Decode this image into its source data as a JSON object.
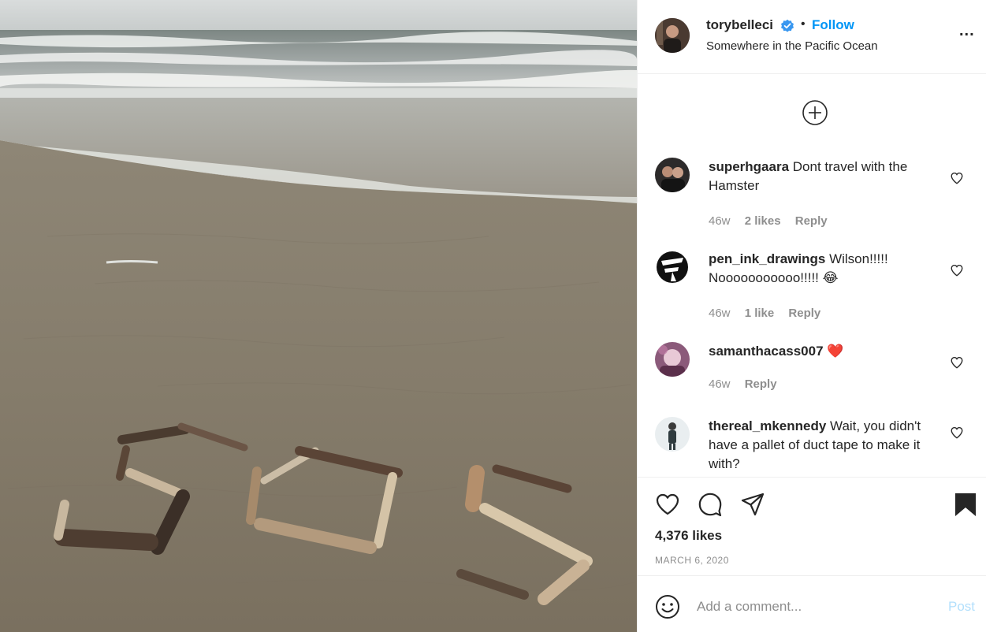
{
  "header": {
    "username": "torybelleci",
    "separator": "•",
    "follow_label": "Follow",
    "location": "Somewhere in the Pacific Ocean",
    "more_label": "..."
  },
  "comments": [
    {
      "username": "superhgaara",
      "text": "Dont travel with the Hamster",
      "time": "46w",
      "likes": "2 likes",
      "reply": "Reply"
    },
    {
      "username": "pen_ink_drawings",
      "text": "Wilson!!!!! Nooooooooooo!!!!! 😂",
      "time": "46w",
      "likes": "1 like",
      "reply": "Reply"
    },
    {
      "username": "samanthacass007",
      "text": "❤️",
      "time": "46w",
      "reply": "Reply"
    },
    {
      "username": "thereal_mkennedy",
      "text": "Wait, you didn't have a pallet of duct tape to make it with?"
    }
  ],
  "post": {
    "likes_text": "4,376 likes",
    "date": "MARCH 6, 2020"
  },
  "add_comment": {
    "placeholder": "Add a comment...",
    "post_label": "Post"
  },
  "icons": {
    "verified": "verified-badge-icon",
    "load_more": "plus-circle-icon",
    "comment_like": "heart-outline-icon",
    "like": "heart-outline-icon",
    "comment": "speech-bubble-icon",
    "share": "paper-plane-icon",
    "save": "bookmark-filled-icon",
    "emoji": "smiley-icon"
  },
  "colors": {
    "accent": "#0095f6",
    "verified": "#3897f0",
    "post_disabled": "#b2dffc",
    "text": "#262626",
    "muted": "#8e8e8e",
    "heart_red": "#ed4956"
  }
}
